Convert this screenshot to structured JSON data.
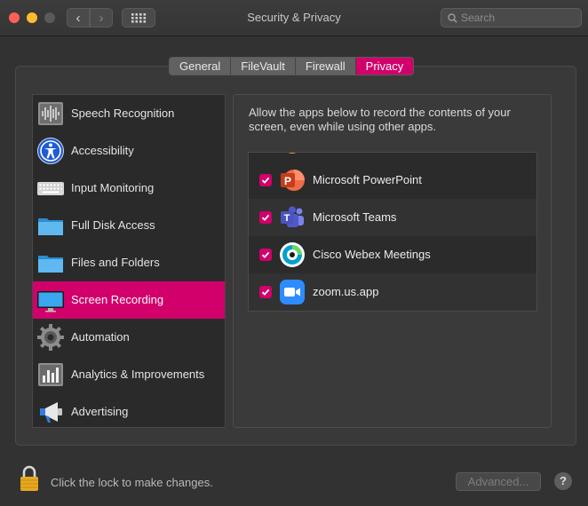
{
  "window": {
    "title": "Security & Privacy"
  },
  "toolbar": {
    "back_glyph": "‹",
    "forward_glyph": "›",
    "search_placeholder": "Search"
  },
  "tabs": [
    {
      "label": "General",
      "active": false
    },
    {
      "label": "FileVault",
      "active": false
    },
    {
      "label": "Firewall",
      "active": false
    },
    {
      "label": "Privacy",
      "active": true
    }
  ],
  "sidebar": {
    "items": [
      {
        "label": "Speech Recognition",
        "icon": "waveform-icon"
      },
      {
        "label": "Accessibility",
        "icon": "accessibility-icon"
      },
      {
        "label": "Input Monitoring",
        "icon": "keyboard-icon"
      },
      {
        "label": "Full Disk Access",
        "icon": "folder-icon"
      },
      {
        "label": "Files and Folders",
        "icon": "folder-icon"
      },
      {
        "label": "Screen Recording",
        "icon": "display-icon",
        "selected": true
      },
      {
        "label": "Automation",
        "icon": "gear-icon"
      },
      {
        "label": "Analytics & Improvements",
        "icon": "chart-icon"
      },
      {
        "label": "Advertising",
        "icon": "megaphone-icon"
      }
    ]
  },
  "content": {
    "description": "Allow the apps below to record the contents of your screen, even while using other apps.",
    "apps": [
      {
        "label": "Microsoft PowerPoint",
        "checked": true,
        "icon": "powerpoint-icon"
      },
      {
        "label": "Microsoft Teams",
        "checked": true,
        "icon": "teams-icon"
      },
      {
        "label": "Cisco Webex Meetings",
        "checked": true,
        "icon": "webex-icon"
      },
      {
        "label": "zoom.us.app",
        "checked": true,
        "icon": "zoom-icon"
      }
    ]
  },
  "footer": {
    "lock_text": "Click the lock to make changes.",
    "advanced_label": "Advanced...",
    "help_label": "?"
  },
  "colors": {
    "accent": "#d1006a",
    "close": "#ff5f57",
    "minimize": "#febc2e",
    "zoom_disabled": "#5a5a5a",
    "lock": "#e7a91f"
  }
}
